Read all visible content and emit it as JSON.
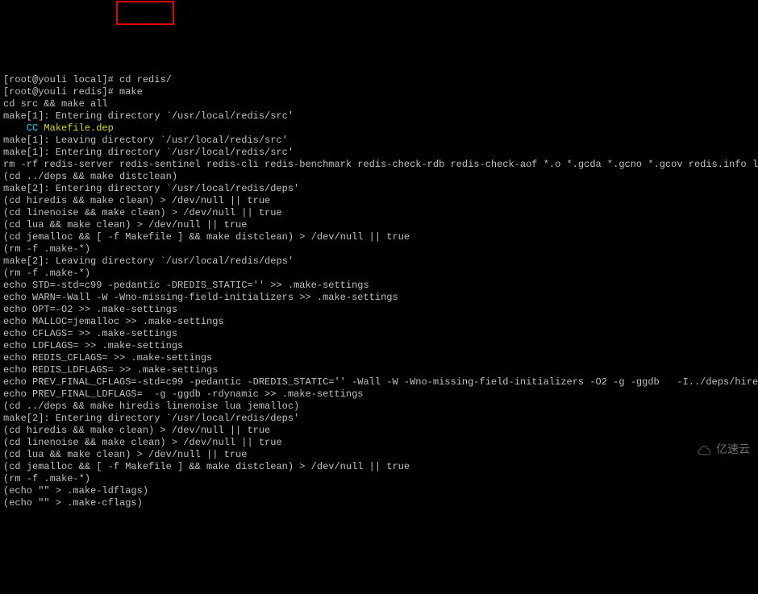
{
  "terminal": {
    "prompt1_prefix": "[root@youli local]# ",
    "prompt1_cmd": "cd redis/",
    "prompt2_prefix": "[root@youli redis]# ",
    "prompt2_cmd": "make",
    "lines": [
      "cd src && make all",
      "make[1]: Entering directory `/usr/local/redis/src'",
      "__CC_DEP__",
      "make[1]: Leaving directory `/usr/local/redis/src'",
      "make[1]: Entering directory `/usr/local/redis/src'",
      "rm -rf redis-server redis-sentinel redis-cli redis-benchmark redis-check-rdb redis-check-aof *.o *.gcda *.gcno *.gcov redis.info lcov-html Makefile.dep dict-benchmark",
      "(cd ../deps && make distclean)",
      "make[2]: Entering directory `/usr/local/redis/deps'",
      "(cd hiredis && make clean) > /dev/null || true",
      "(cd linenoise && make clean) > /dev/null || true",
      "(cd lua && make clean) > /dev/null || true",
      "(cd jemalloc && [ -f Makefile ] && make distclean) > /dev/null || true",
      "(rm -f .make-*)",
      "make[2]: Leaving directory `/usr/local/redis/deps'",
      "(rm -f .make-*)",
      "echo STD=-std=c99 -pedantic -DREDIS_STATIC='' >> .make-settings",
      "echo WARN=-Wall -W -Wno-missing-field-initializers >> .make-settings",
      "echo OPT=-O2 >> .make-settings",
      "echo MALLOC=jemalloc >> .make-settings",
      "echo CFLAGS= >> .make-settings",
      "echo LDFLAGS= >> .make-settings",
      "echo REDIS_CFLAGS= >> .make-settings",
      "echo REDIS_LDFLAGS= >> .make-settings",
      "echo PREV_FINAL_CFLAGS=-std=c99 -pedantic -DREDIS_STATIC='' -Wall -W -Wno-missing-field-initializers -O2 -g -ggdb   -I../deps/hiredis -I../deps/linenoise -I../deps/lua/src -DUSE_JEMALLOC -I../deps/jemalloc/include >> .make-settings",
      "echo PREV_FINAL_LDFLAGS=  -g -ggdb -rdynamic >> .make-settings",
      "(cd ../deps && make hiredis linenoise lua jemalloc)",
      "make[2]: Entering directory `/usr/local/redis/deps'",
      "(cd hiredis && make clean) > /dev/null || true",
      "(cd linenoise && make clean) > /dev/null || true",
      "(cd lua && make clean) > /dev/null || true",
      "(cd jemalloc && [ -f Makefile ] && make distclean) > /dev/null || true",
      "(rm -f .make-*)",
      "(echo \"\" > .make-ldflags)",
      "(echo \"\" > .make-cflags)"
    ],
    "cc_prefix": "    CC ",
    "cc_file": "Makefile.dep"
  },
  "watermark": {
    "text": "亿速云"
  }
}
